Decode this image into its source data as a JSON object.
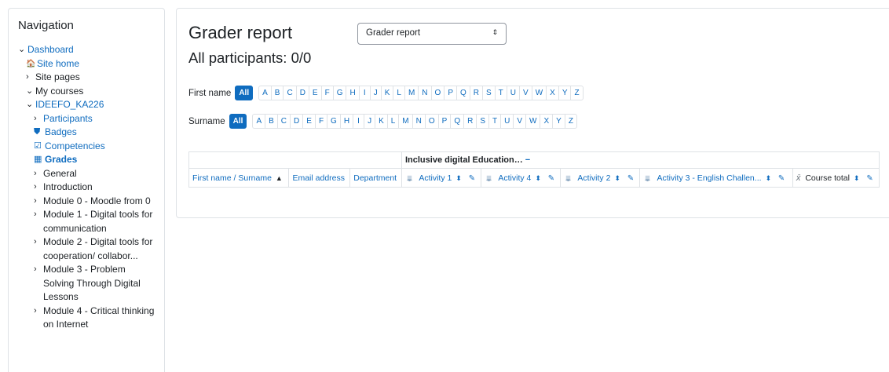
{
  "navigation": {
    "title": "Navigation",
    "items": [
      {
        "arrow": "⌄",
        "icon": "",
        "label": "Dashboard",
        "style": "link",
        "indent": 1
      },
      {
        "arrow": "",
        "icon": "home-icon",
        "label": "Site home",
        "style": "link",
        "indent": 2
      },
      {
        "arrow": "›",
        "icon": "",
        "label": "Site pages",
        "style": "plain",
        "indent": 2
      },
      {
        "arrow": "⌄",
        "icon": "",
        "label": "My courses",
        "style": "plain",
        "indent": 2
      },
      {
        "arrow": "⌄",
        "icon": "",
        "label": "IDEEFO_KA226",
        "style": "link",
        "indent": 3
      },
      {
        "arrow": "›",
        "icon": "",
        "label": "Participants",
        "style": "link",
        "indent": 4
      },
      {
        "arrow": "",
        "icon": "shield-icon",
        "label": "Badges",
        "style": "link",
        "indent": 4
      },
      {
        "arrow": "",
        "icon": "checkbox-icon",
        "label": "Competencies",
        "style": "link",
        "indent": 4
      },
      {
        "arrow": "",
        "icon": "table-icon",
        "label": "Grades",
        "style": "bold-link",
        "indent": 4
      },
      {
        "arrow": "›",
        "icon": "",
        "label": "General",
        "style": "plain",
        "indent": 4
      },
      {
        "arrow": "›",
        "icon": "",
        "label": "Introduction",
        "style": "plain",
        "indent": 4
      },
      {
        "arrow": "›",
        "icon": "",
        "label": "Module 0 - Moodle from 0",
        "style": "plain",
        "indent": 4
      },
      {
        "arrow": "›",
        "icon": "",
        "label": "Module 1 - Digital tools for communication",
        "style": "plain",
        "indent": 4
      },
      {
        "arrow": "›",
        "icon": "",
        "label": "Module 2 - Digital tools for cooperation/ collabor...",
        "style": "plain",
        "indent": 4
      },
      {
        "arrow": "›",
        "icon": "",
        "label": "Module 3 - Problem Solving Through Digital Lessons",
        "style": "plain",
        "indent": 4
      },
      {
        "arrow": "›",
        "icon": "",
        "label": "Module 4 - Critical thinking on Internet",
        "style": "plain",
        "indent": 4
      }
    ]
  },
  "main": {
    "title": "Grader report",
    "report_select": {
      "value": "Grader report"
    },
    "subtitle": "All participants: 0/0",
    "first_name_filter": {
      "label": "First name",
      "all": "All",
      "letters": [
        "A",
        "B",
        "C",
        "D",
        "E",
        "F",
        "G",
        "H",
        "I",
        "J",
        "K",
        "L",
        "M",
        "N",
        "O",
        "P",
        "Q",
        "R",
        "S",
        "T",
        "U",
        "V",
        "W",
        "X",
        "Y",
        "Z"
      ]
    },
    "surname_filter": {
      "label": "Surname",
      "all": "All",
      "letters": [
        "A",
        "B",
        "C",
        "D",
        "E",
        "F",
        "G",
        "H",
        "I",
        "J",
        "K",
        "L",
        "M",
        "N",
        "O",
        "P",
        "Q",
        "R",
        "S",
        "T",
        "U",
        "V",
        "W",
        "X",
        "Y",
        "Z"
      ]
    },
    "grader_table": {
      "category": "Inclusive digital Education…",
      "category_toggle": "−",
      "columns": {
        "name": "First name / Surname",
        "email": "Email address",
        "department": "Department",
        "activity1": "Activity 1",
        "activity4": "Activity 4",
        "activity2": "Activity 2",
        "activity3": "Activity 3 - English Challen...",
        "course_total": "Course total"
      }
    }
  },
  "colors": {
    "accent": "#0f6cbf",
    "border": "#dee2e6",
    "text": "#1d2125"
  }
}
